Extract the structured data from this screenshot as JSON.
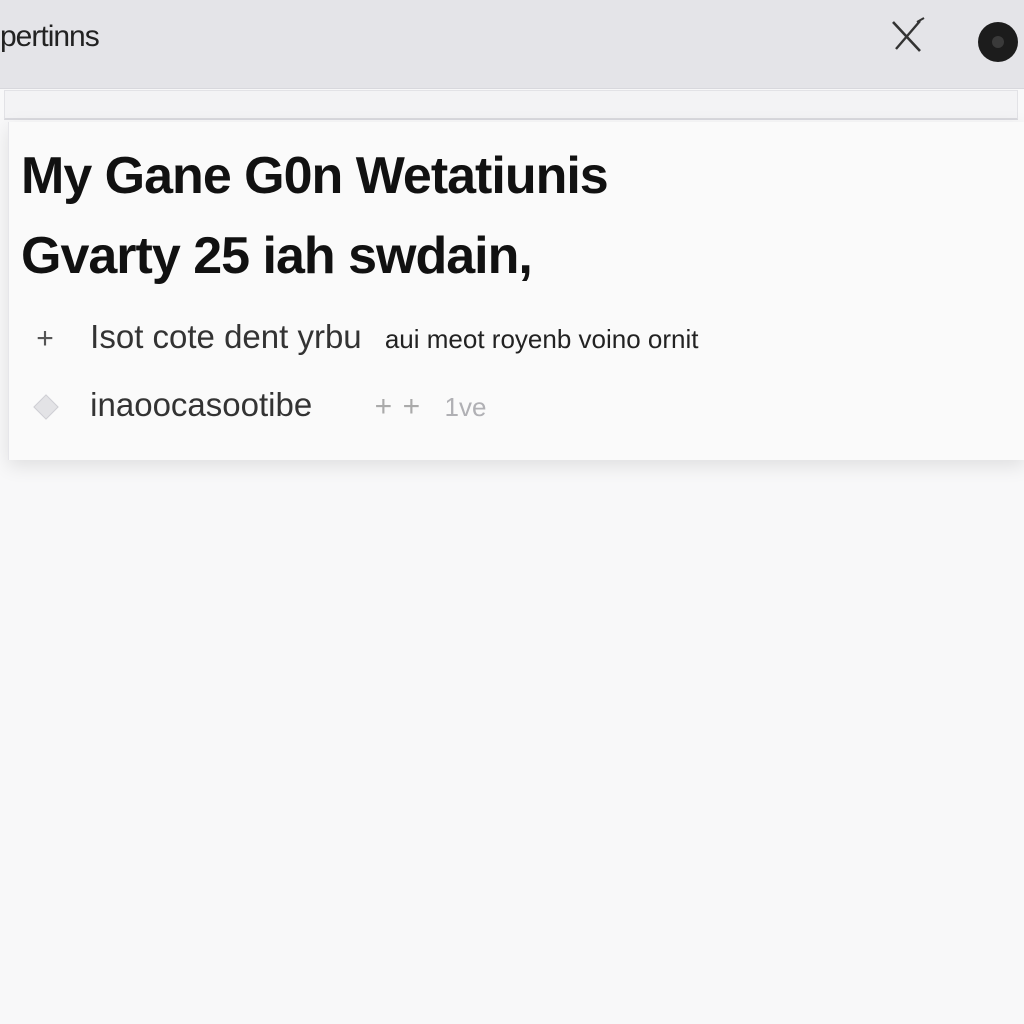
{
  "topbar": {
    "title": "pertinns",
    "close_icon": "close-icon",
    "avatar_icon": "avatar"
  },
  "card": {
    "headline_line1": "My Gane G0n Wetatiunis",
    "headline_line2": "Gvarty 25 iah swdain,",
    "row1": {
      "icon": "plus-icon",
      "text_main": "Isot cote dent yrbu",
      "text_small": "aui meot royenb voino ornit"
    },
    "row2": {
      "icon": "diamond-icon",
      "text": "inaoocasootibe",
      "faint_icons": "plus-icons",
      "faint_text": "1ve"
    }
  }
}
